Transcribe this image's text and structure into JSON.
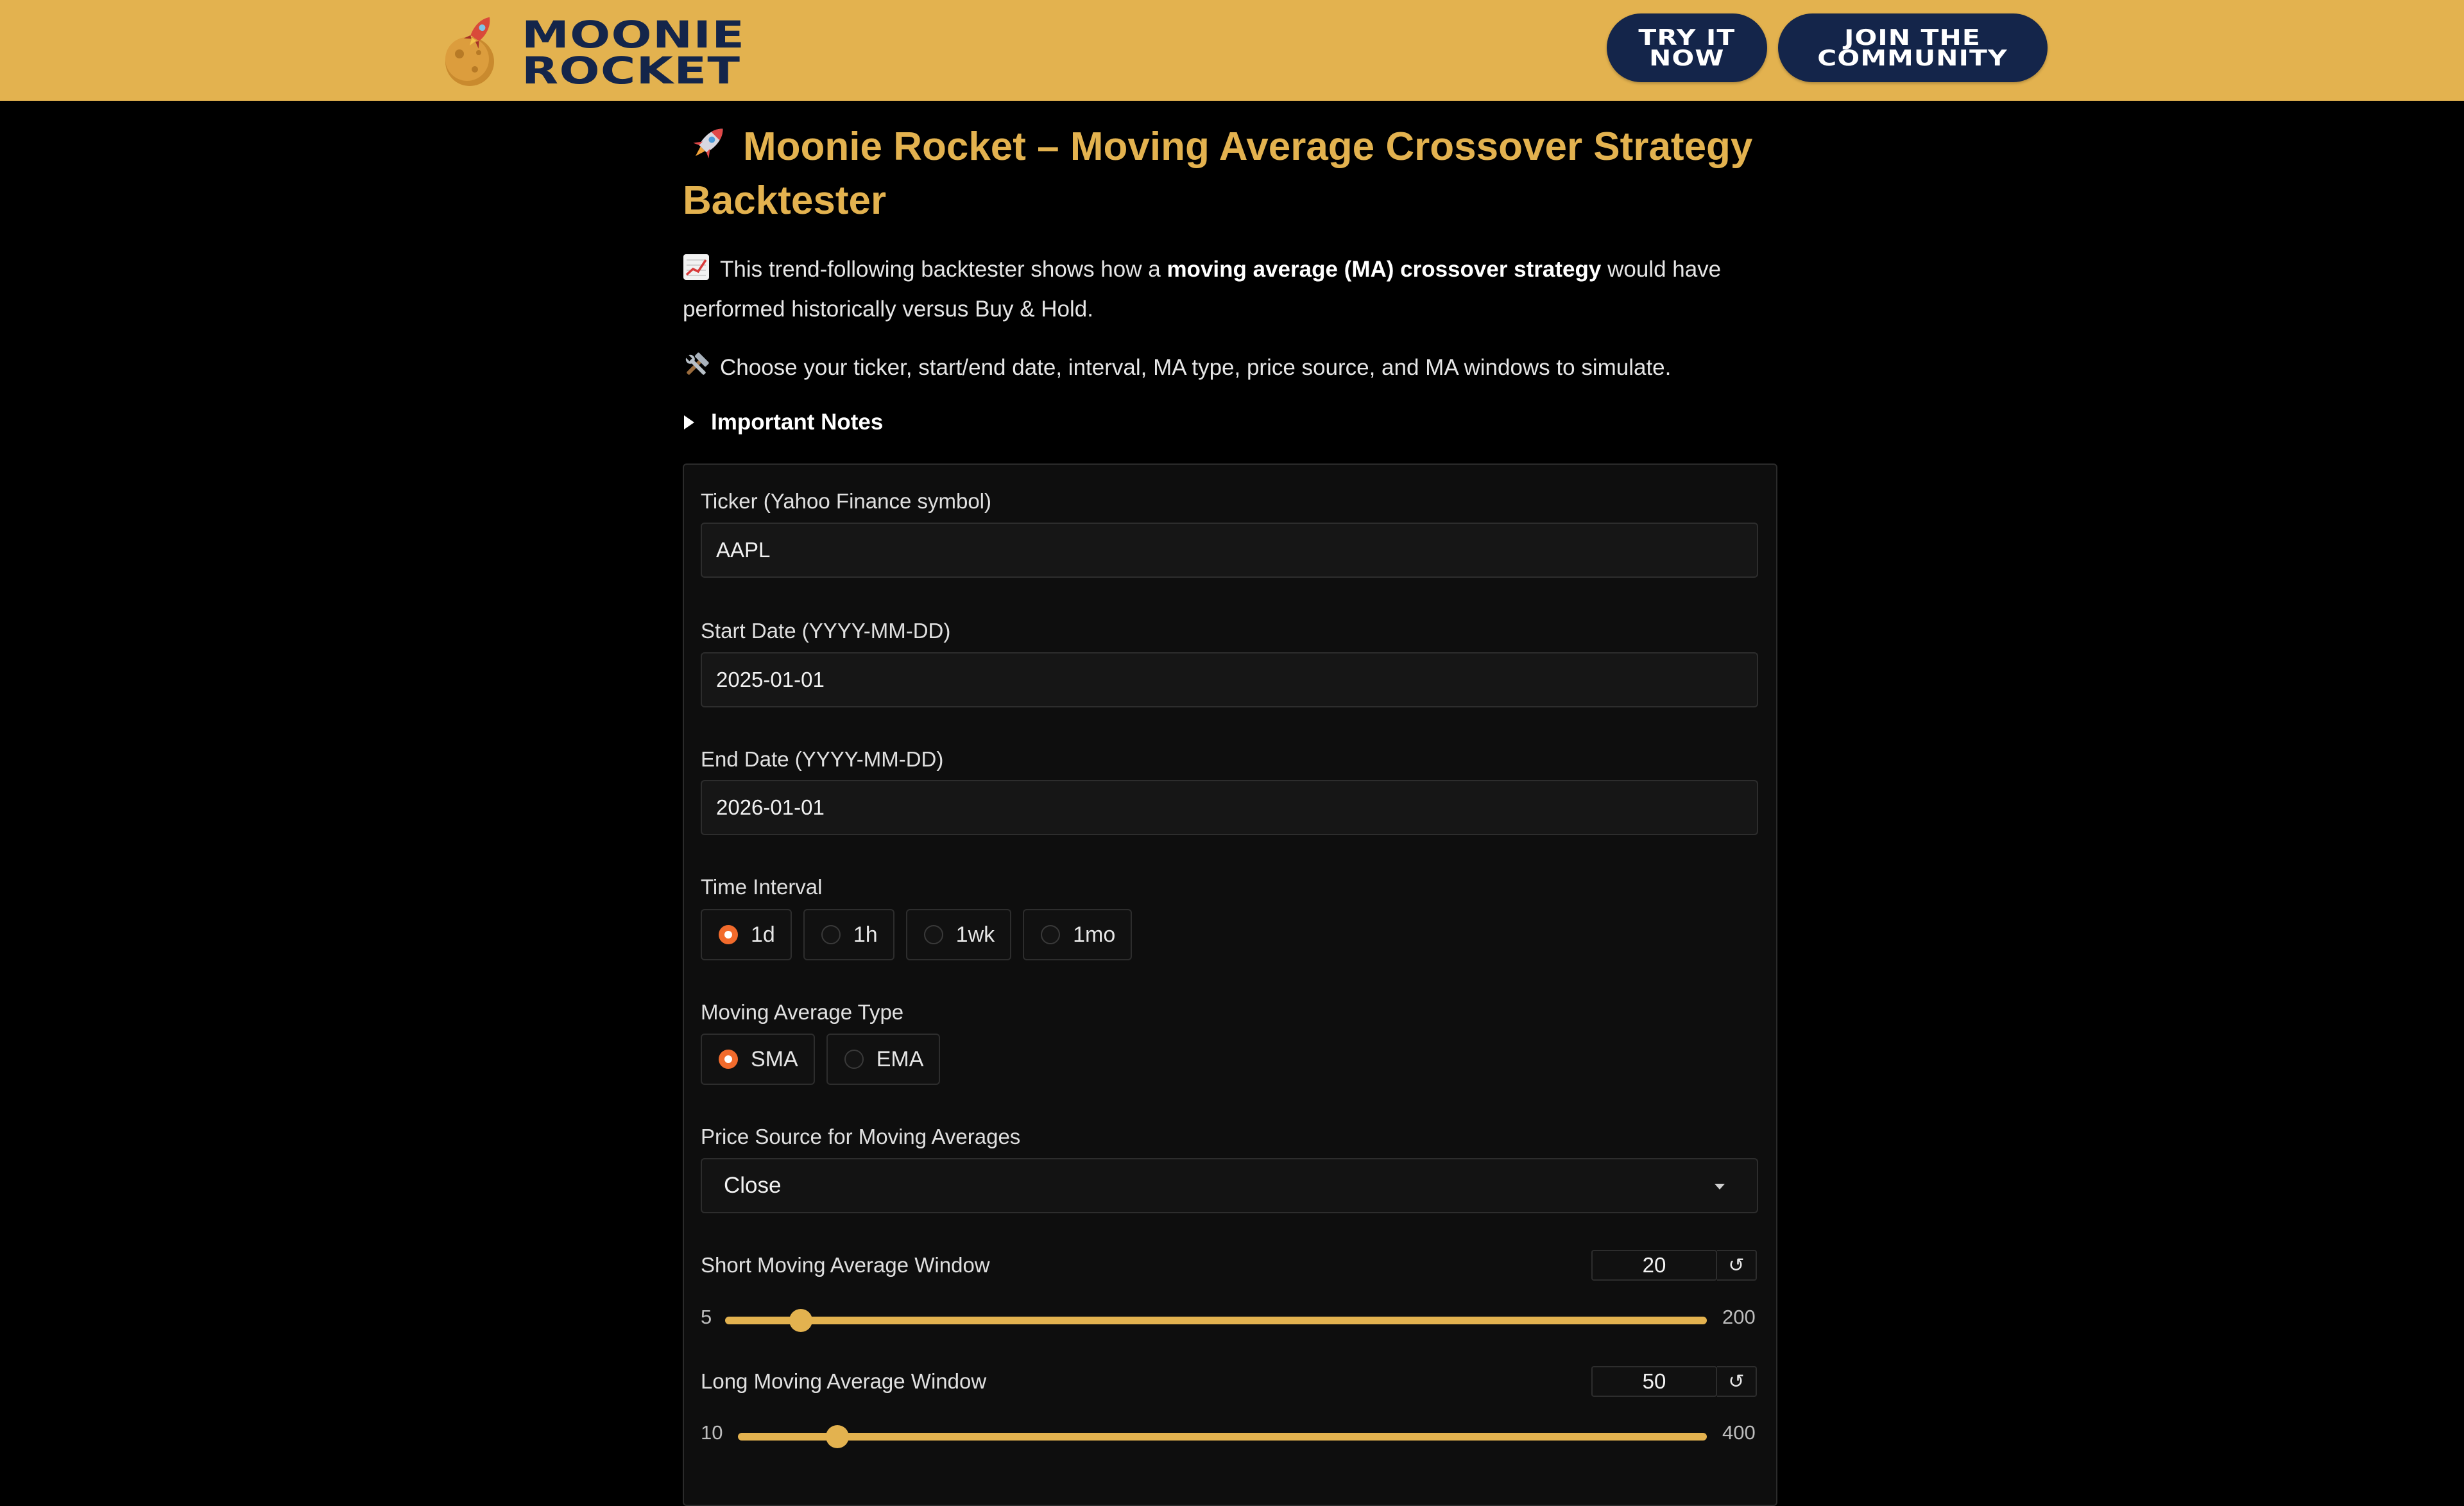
{
  "header": {
    "logo_line1": "MOONIE",
    "logo_line2": "ROCKET",
    "try_label": "TRY IT\nNOW",
    "join_label": "JOIN THE\nCOMMUNITY"
  },
  "title": "Moonie Rocket – Moving Average Crossover Strategy Backtester",
  "intro": {
    "part1": "This trend-following backtester shows how a ",
    "bold": "moving average (MA) crossover strategy",
    "part2": " would have performed historically versus Buy & Hold."
  },
  "instructions": "Choose your ticker, start/end date, interval, MA type, price source, and MA windows to simulate.",
  "notes_label": "Important Notes",
  "form": {
    "ticker": {
      "label": "Ticker (Yahoo Finance symbol)",
      "value": "AAPL"
    },
    "start_date": {
      "label": "Start Date (YYYY-MM-DD)",
      "value": "2025-01-01"
    },
    "end_date": {
      "label": "End Date (YYYY-MM-DD)",
      "value": "2026-01-01"
    },
    "interval": {
      "label": "Time Interval",
      "options": [
        "1d",
        "1h",
        "1wk",
        "1mo"
      ],
      "selected": "1d"
    },
    "ma_type": {
      "label": "Moving Average Type",
      "options": [
        "SMA",
        "EMA"
      ],
      "selected": "SMA"
    },
    "price_source": {
      "label": "Price Source for Moving Averages",
      "value": "Close"
    },
    "short_window": {
      "label": "Short Moving Average Window",
      "value": 20,
      "min": 5,
      "max": 200
    },
    "long_window": {
      "label": "Long Moving Average Window",
      "value": 50,
      "min": 10,
      "max": 400
    }
  },
  "colors": {
    "accent": "#e3b24f",
    "navy": "#14254a",
    "radio_on": "#f26b2c",
    "background": "#000000"
  },
  "icons": {
    "rocket": "rocket-icon",
    "chart": "chart-increasing-icon",
    "tools": "hammer-wrench-icon",
    "reset": "reset-icon"
  }
}
